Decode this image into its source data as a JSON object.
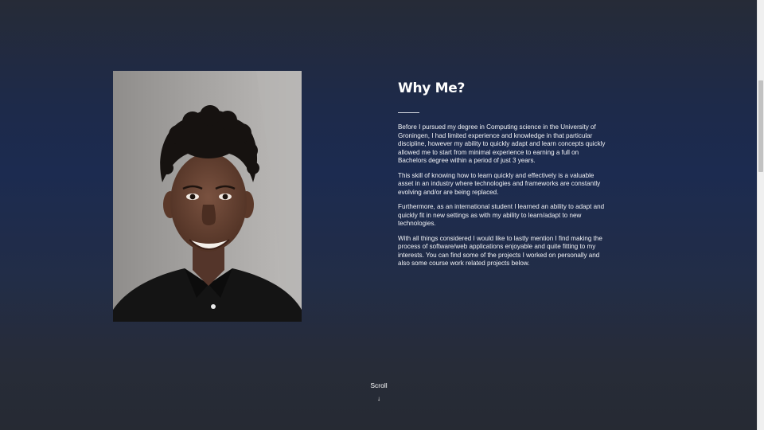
{
  "about": {
    "photo_alt": "Portrait photo",
    "title": "Why Me?",
    "paragraphs": [
      "Before I pursued my degree in Computing science in the University of Groningen, I had limited experience and knowledge in that particular discipline, however my ability to quickly adapt and learn concepts quickly allowed me to start from minimal experience to earning a full on Bachelors degree within a period of just 3 years.",
      "This skill of knowing how to learn quickly and effectively is a valuable asset in an industry where technologies and frameworks are constantly evolving and/or are being replaced.",
      "Furthermore, as an international student I learned an ability to adapt and quickly fit in new settings as with my ability to learn/adapt to new technologies.",
      "With all things considered I would like to lastly mention I find making the process of software/web applications enjoyable and quite fitting to my interests. You can find some of the projects I worked on personally and also some course work related projects below."
    ]
  },
  "scroll": {
    "label": "Scroll",
    "arrow": "↓"
  }
}
